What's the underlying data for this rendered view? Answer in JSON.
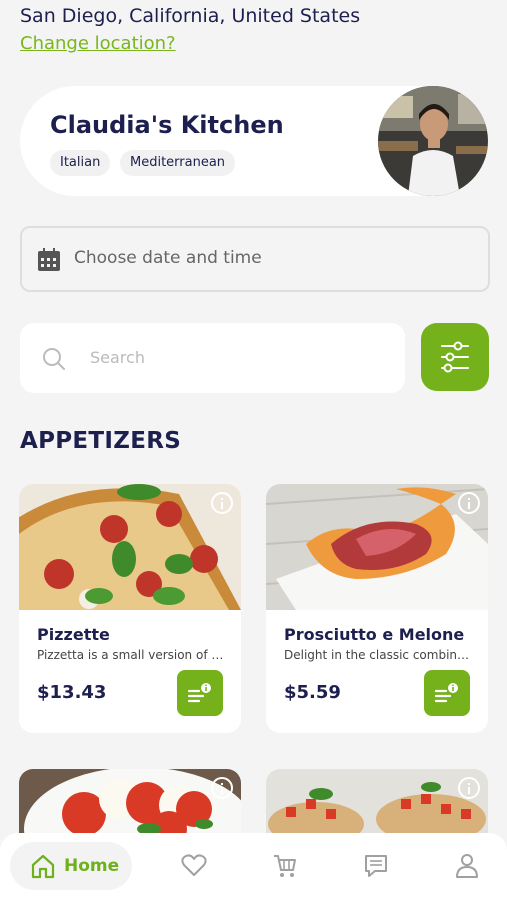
{
  "location": {
    "current": "San Diego, California, United States",
    "change_link": "Change location?"
  },
  "chef": {
    "name": "Claudia's Kitchen",
    "tags": [
      "Italian",
      "Mediterranean"
    ]
  },
  "date_picker": {
    "placeholder": "Choose date and time"
  },
  "search": {
    "placeholder": "Search"
  },
  "section_title": "APPETIZERS",
  "dishes": [
    {
      "name": "Pizzette",
      "description": "Pizzetta is a small version of pizza",
      "price": "$13.43"
    },
    {
      "name": "Prosciutto e Melone",
      "description": "Delight in the classic combination of prosciutto and melon",
      "price": "$5.59"
    }
  ],
  "nav": {
    "home_label": "Home"
  },
  "colors": {
    "accent": "#75b11b",
    "navy": "#1d1f4e",
    "background": "#f4f4f4"
  }
}
